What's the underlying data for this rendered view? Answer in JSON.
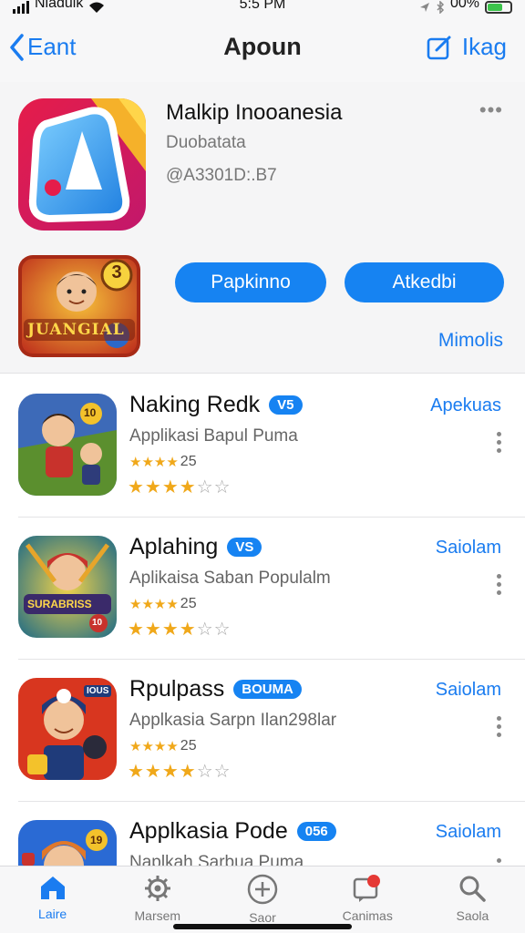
{
  "status_bar": {
    "carrier": "Nladuik",
    "time": "5:5 PM",
    "battery": "00%"
  },
  "nav": {
    "back_label": "Eant",
    "title": "Apoun",
    "right_label": "Ikag"
  },
  "hero": {
    "app_name": "Malkip Inooanesia",
    "developer": "Duobatata",
    "app_id": "@A3301D:.B7",
    "primary_button": "Papkinno",
    "secondary_button": "Atkedbi",
    "more_link": "Mimolis",
    "game_badge": "3",
    "game_title": "JUANGIAL"
  },
  "apps": [
    {
      "title": "Naking Redk",
      "badge": "V5",
      "subtitle": "Applikasi Bapul Puma",
      "rating_count": "25",
      "action": "Apekuas",
      "icon_badge": "10"
    },
    {
      "title": "Aplahing",
      "badge": "VS",
      "subtitle": "Aplikaisa Saban Populalm",
      "rating_count": "25",
      "action": "Saiolam",
      "icon_text": "SURABRISS",
      "icon_badge": "10"
    },
    {
      "title": "Rpulpass",
      "badge": "BOUMA",
      "subtitle": "Applkasia Sarpn Ilan298lar",
      "rating_count": "25",
      "action": "Saiolam",
      "icon_badge": "IOUS"
    },
    {
      "title": "Applkasia Pode",
      "badge": "056",
      "subtitle": "Naplkah Sarbua Puma",
      "rating_count": "",
      "action": "Saiolam",
      "icon_badge": "19"
    }
  ],
  "tabs": [
    {
      "label": "Laire",
      "icon": "home-icon"
    },
    {
      "label": "Marsem",
      "icon": "gear-icon"
    },
    {
      "label": "Saor",
      "icon": "plus-icon"
    },
    {
      "label": "Canimas",
      "icon": "chat-icon"
    },
    {
      "label": "Saola",
      "icon": "search-icon"
    }
  ],
  "colors": {
    "accent": "#1683f2",
    "star": "#f0a81a"
  }
}
